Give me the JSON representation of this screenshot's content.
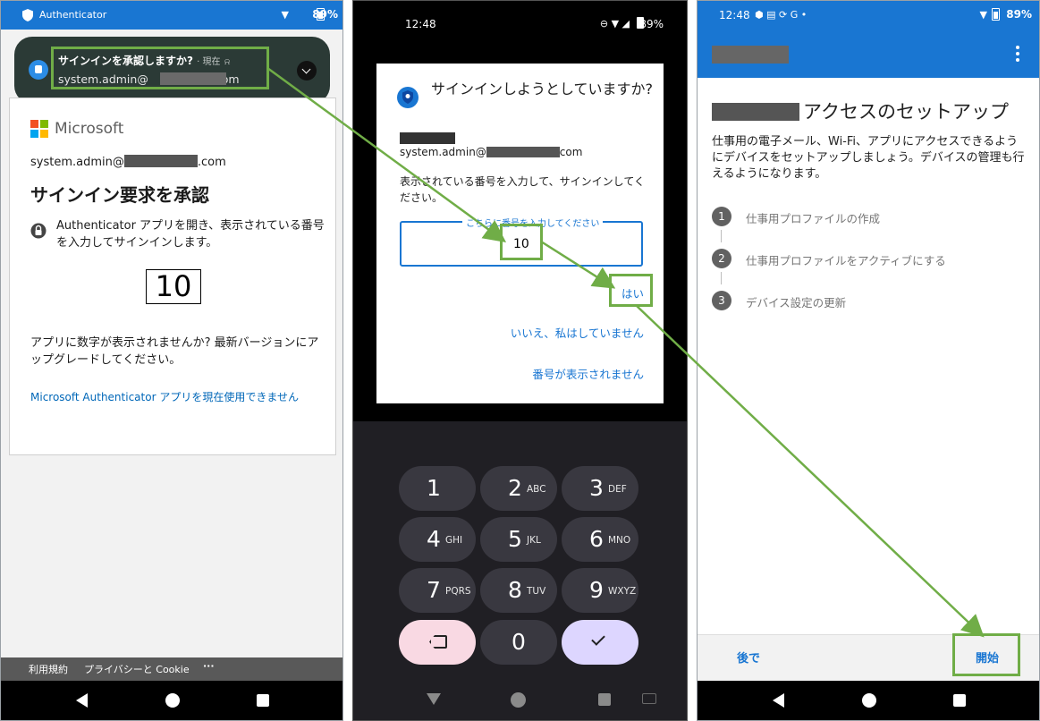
{
  "phone1": {
    "status": {
      "app": "Authenticator",
      "battery": "89%"
    },
    "notification": {
      "title": "サインインを承認しますか?",
      "meta": "· 現在",
      "account_prefix": "system.admin@",
      "account_suffix": "com"
    },
    "card": {
      "brand": "Microsoft",
      "account_prefix": "system.admin@",
      "account_suffix": ".com",
      "title": "サインイン要求を承認",
      "description": "Authenticator アプリを開き、表示されている番号を入力してサインインします。",
      "number": "10",
      "help_text": "アプリに数字が表示されませんか? 最新バージョンにアップグレードしてください。",
      "link": "Microsoft Authenticator アプリを現在使用できません"
    },
    "footer": {
      "terms": "利用規約",
      "privacy": "プライバシーと Cookie",
      "more": "···"
    }
  },
  "phone2": {
    "status": {
      "time": "12:48",
      "battery": "89%"
    },
    "dialog": {
      "title": "サインインしようとしていますか?",
      "account_prefix": "system.admin@",
      "account_suffix": "com",
      "instruction": "表示されている番号を入力して、サインインしてください。",
      "field_label": "こちらに番号を入力してください",
      "field_value": "10",
      "yes": "はい",
      "no": "いいえ、私はしていません",
      "no_number": "番号が表示されません"
    },
    "keypad": [
      {
        "digit": "1",
        "letters": ""
      },
      {
        "digit": "2",
        "letters": "ABC"
      },
      {
        "digit": "3",
        "letters": "DEF"
      },
      {
        "digit": "4",
        "letters": "GHI"
      },
      {
        "digit": "5",
        "letters": "JKL"
      },
      {
        "digit": "6",
        "letters": "MNO"
      },
      {
        "digit": "7",
        "letters": "PQRS"
      },
      {
        "digit": "8",
        "letters": "TUV"
      },
      {
        "digit": "9",
        "letters": "WXYZ"
      },
      {
        "digit": "0",
        "letters": ""
      }
    ]
  },
  "phone3": {
    "status": {
      "time": "12:48",
      "icons": "G •",
      "battery": "89%"
    },
    "title": "アクセスのセットアップ",
    "body": "仕事用の電子メール、Wi-Fi、アプリにアクセスできるようにデバイスをセットアップしましょう。デバイスの管理も行えるようになります。",
    "steps": [
      {
        "num": "1",
        "label": "仕事用プロファイルの作成"
      },
      {
        "num": "2",
        "label": "仕事用プロファイルをアクティブにする"
      },
      {
        "num": "3",
        "label": "デバイス設定の更新"
      }
    ],
    "later": "後で",
    "start": "開始"
  },
  "colors": {
    "accent": "#1976d2",
    "highlight": "#70ad47",
    "notification_bg": "#2b3a36",
    "keypad_bg": "#201f24"
  }
}
